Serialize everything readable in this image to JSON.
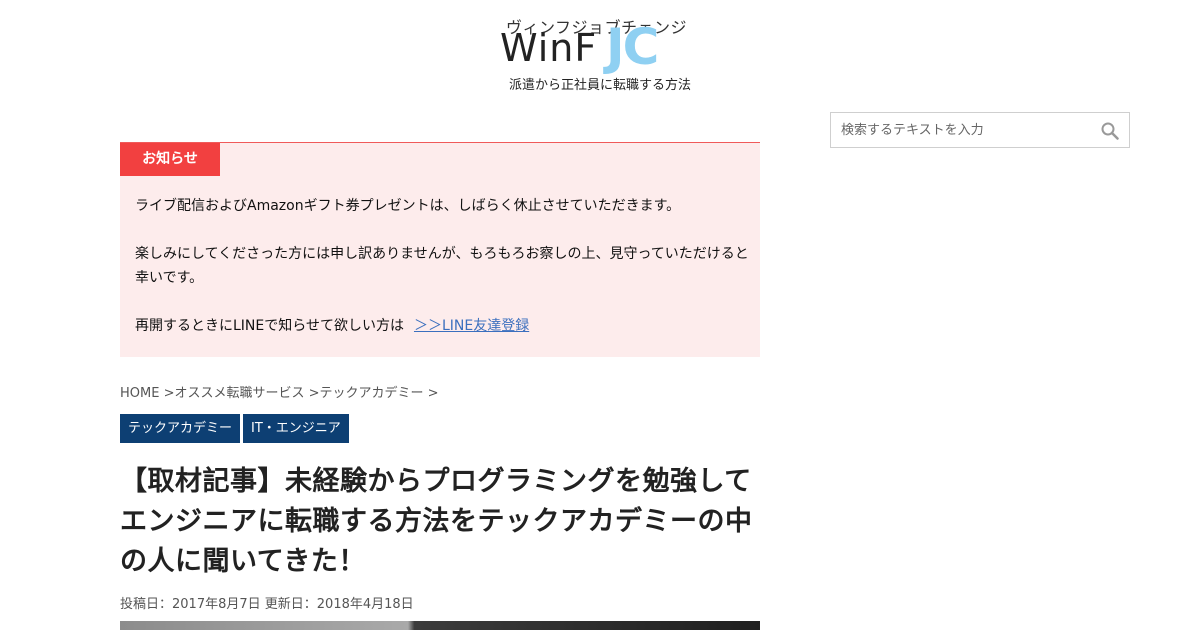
{
  "header": {
    "logo_kana": "ヴィンフジョブチェンジ",
    "logo_win": "WinF",
    "logo_jc": "JC",
    "tagline": "派遣から正社員に転職する方法"
  },
  "search": {
    "placeholder": "検索するテキストを入力",
    "icon": "search-icon"
  },
  "notice": {
    "label": "お知らせ",
    "line1": "ライブ配信およびAmazonギフト券プレゼントは、しばらく休止させていただきます。",
    "line2": "楽しみにしてくださった方には申し訳ありませんが、もろもろお察しの上、見守っていただけると幸いです。",
    "line3": "再開するときにLINEで知らせて欲しい方は",
    "link": "＞＞LINE友達登録"
  },
  "breadcrumb": {
    "items": [
      "HOME >",
      "オススメ転職サービス >",
      "テックアカデミー >"
    ]
  },
  "categories": [
    "テックアカデミー",
    "IT・エンジニア"
  ],
  "article": {
    "title": "【取材記事】未経験からプログラミングを勉強してエンジニアに転職する方法をテックアカデミーの中の人に聞いてきた！",
    "posted": "投稿日：2017年8月7日",
    "updated": "更新日：2018年4月18日"
  },
  "colors": {
    "notice_label": "#f24040",
    "notice_bg": "#fdecec",
    "category_bg": "#0d3f73",
    "link": "#3b6fbe",
    "logo_accent": "#8fd0f2"
  }
}
